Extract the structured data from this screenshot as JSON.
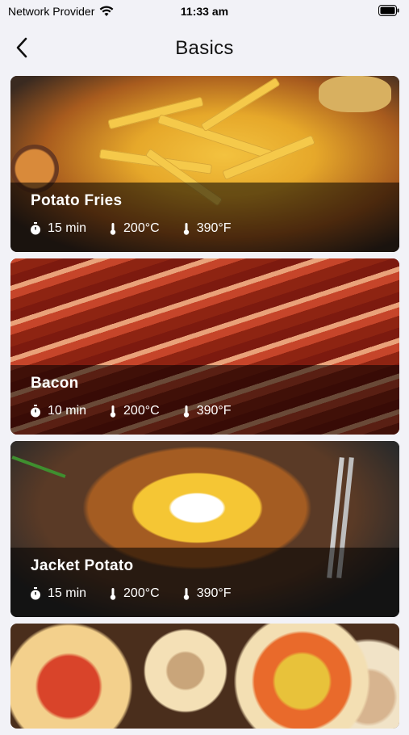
{
  "status_bar": {
    "carrier": "Network Provider",
    "time": "11:33 am"
  },
  "nav": {
    "title": "Basics"
  },
  "recipes": [
    {
      "name": "Potato Fries",
      "time": "15 min",
      "temp_c": "200°C",
      "temp_f": "390°F"
    },
    {
      "name": "Bacon",
      "time": "10 min",
      "temp_c": "200°C",
      "temp_f": "390°F"
    },
    {
      "name": "Jacket Potato",
      "time": "15 min",
      "temp_c": "200°C",
      "temp_f": "390°F"
    }
  ],
  "icons": {
    "back": "chevron-left-icon",
    "wifi": "wifi-icon",
    "battery": "battery-icon",
    "timer": "stopwatch-icon",
    "thermometer": "thermometer-icon"
  }
}
